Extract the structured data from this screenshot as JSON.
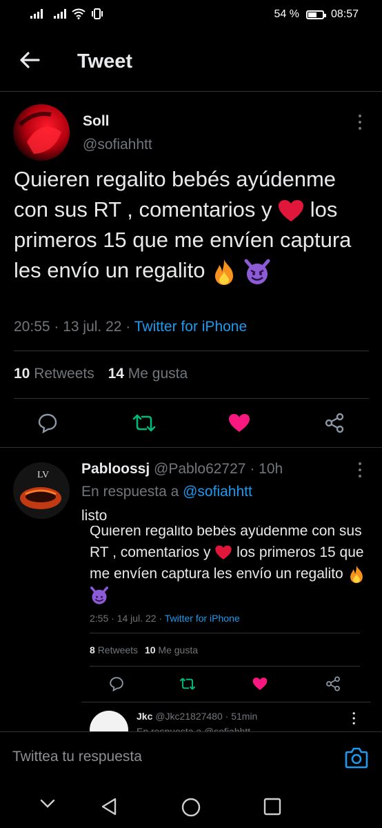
{
  "status_bar": {
    "battery": "54 %",
    "time": "08:57"
  },
  "header": {
    "title": "Tweet"
  },
  "tweet": {
    "name": "Soll",
    "handle": "@sofiahhtt",
    "text_1": "Quieren regalito bebés ayúdenme con sus RT , comentarios y",
    "text_2": "los primeros 15 que me envíen captura les envío un regalito",
    "date": "20:55 · 13 jul. 22 ·",
    "source": "Twitter for iPhone",
    "retweets_count": "10",
    "retweets_label": "Retweets",
    "likes_count": "14",
    "likes_label": "Me gusta"
  },
  "reply": {
    "name": "Pabloossj",
    "handle": "@Pablo62727",
    "time": "· 10h",
    "replying_prefix": "En respuesta a",
    "replying_to": "@sofiahhtt",
    "text": "listo",
    "screenshot": {
      "text_1": "Quieren regalito bebés ayúdenme con sus RT , comentarios y",
      "text_2": "los primeros 15 que me envíen captura les envío un regalito",
      "date": "2:55 · 14 jul. 22 ·",
      "source": "Twitter for iPhone",
      "retweets_count": "8",
      "retweets_label": "Retweets",
      "likes_count": "10",
      "likes_label": "Me gusta",
      "next_name": "Jkc",
      "next_handle": "@Jkc21827480",
      "next_time": "· 51min",
      "next_partial": "En respuesta a @sofiahhtt"
    }
  },
  "compose": {
    "placeholder": "Twittea tu respuesta"
  },
  "colors": {
    "accent": "#1d9bf0",
    "retweet": "#00ba7c",
    "like": "#f91880",
    "background": "#000000"
  }
}
